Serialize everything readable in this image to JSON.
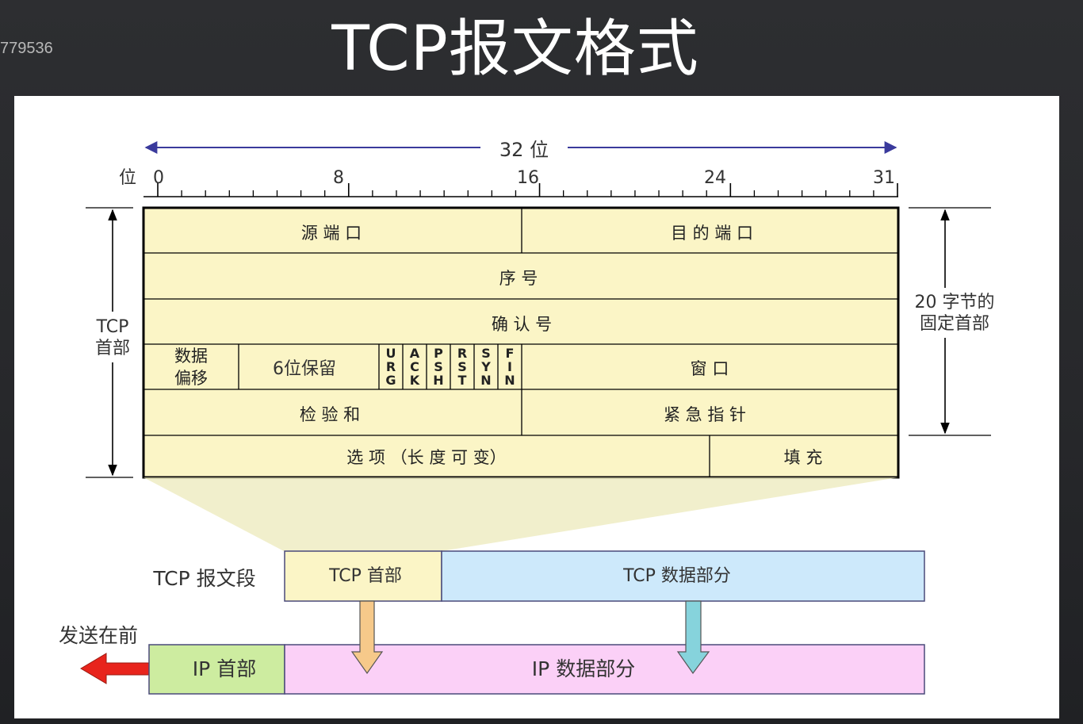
{
  "page": {
    "corner_id": "779536",
    "title": "TCP报文格式"
  },
  "scale": {
    "width_label": "32 位",
    "bit_label": "位",
    "ticks": [
      "0",
      "8",
      "16",
      "24",
      "31"
    ]
  },
  "header_fields": {
    "src_port": "源 端 口",
    "dst_port": "目 的 端 口",
    "seq": "序 号",
    "ack_num": "确 认 号",
    "data_offset": [
      "数据",
      "偏移"
    ],
    "reserved": "6位保留",
    "flags": [
      "URG",
      "ACK",
      "PSH",
      "RST",
      "SYN",
      "FIN"
    ],
    "window": "窗 口",
    "checksum": "检 验 和",
    "urgent": "紧 急 指 针",
    "options": "选 项 （长 度 可 变）",
    "padding": "填 充"
  },
  "side_labels": {
    "left": [
      "TCP",
      "首部"
    ],
    "right": [
      "20 字节的",
      "固定首部"
    ]
  },
  "segment": {
    "label": "TCP 报文段",
    "header": "TCP 首部",
    "data": "TCP 数据部分"
  },
  "ip": {
    "send_first": "发送在前",
    "header": "IP 首部",
    "data": "IP 数据部分"
  },
  "colors": {
    "header_fill": "#fbf5c6",
    "tcp_data_fill": "#cde9fb",
    "ip_header_fill": "#cdeca0",
    "ip_data_fill": "#fbd0f7",
    "axis": "#3a3a9c",
    "arrow_left": "#e8241c",
    "down_arrow_orange": "#f6c98a",
    "down_arrow_teal": "#86d3dc"
  }
}
